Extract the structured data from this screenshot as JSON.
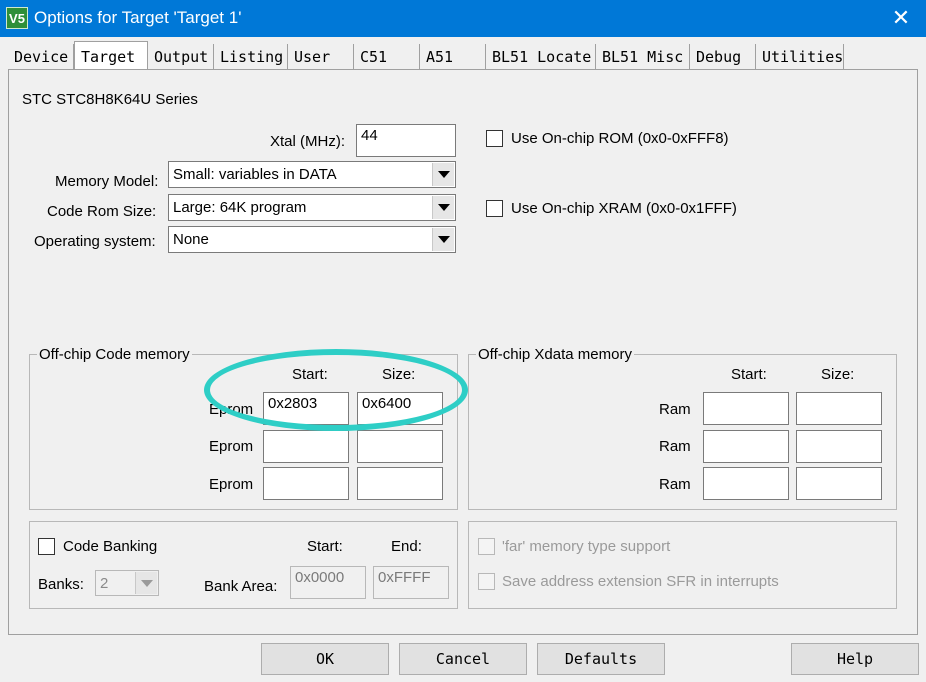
{
  "window": {
    "title": "Options for Target 'Target 1'",
    "app_icon_text": "V5",
    "close_glyph": "✕"
  },
  "tabs": [
    {
      "label": "Device"
    },
    {
      "label": "Target",
      "active": true
    },
    {
      "label": "Output"
    },
    {
      "label": "Listing"
    },
    {
      "label": "User"
    },
    {
      "label": "C51"
    },
    {
      "label": "A51"
    },
    {
      "label": "BL51 Locate"
    },
    {
      "label": "BL51 Misc"
    },
    {
      "label": "Debug"
    },
    {
      "label": "Utilities"
    }
  ],
  "target": {
    "device_series": "STC STC8H8K64U Series",
    "xtal_label": "Xtal (MHz):",
    "xtal_value": "44",
    "memory_model_label": "Memory Model:",
    "memory_model_value": "Small: variables in DATA",
    "code_rom_label": "Code Rom Size:",
    "code_rom_value": "Large: 64K program",
    "os_label": "Operating system:",
    "os_value": "None",
    "onchip_rom_label": "Use On-chip ROM (0x0-0xFFF8)",
    "onchip_xram_label": "Use On-chip XRAM (0x0-0x1FFF)"
  },
  "code_memory": {
    "title": "Off-chip Code memory",
    "start_header": "Start:",
    "size_header": "Size:",
    "rows": [
      {
        "label": "Eprom",
        "start": "0x2803",
        "size": "0x6400"
      },
      {
        "label": "Eprom",
        "start": "",
        "size": ""
      },
      {
        "label": "Eprom",
        "start": "",
        "size": ""
      }
    ]
  },
  "xdata_memory": {
    "title": "Off-chip Xdata memory",
    "start_header": "Start:",
    "size_header": "Size:",
    "rows": [
      {
        "label": "Ram",
        "start": "",
        "size": ""
      },
      {
        "label": "Ram",
        "start": "",
        "size": ""
      },
      {
        "label": "Ram",
        "start": "",
        "size": ""
      }
    ]
  },
  "banking": {
    "code_banking_label": "Code Banking",
    "banks_label": "Banks:",
    "banks_value": "2",
    "start_header": "Start:",
    "end_header": "End:",
    "bank_area_label": "Bank Area:",
    "bank_area_start": "0x0000",
    "bank_area_end": "0xFFFF"
  },
  "misc": {
    "far_memory_label": "'far' memory type support",
    "save_sfr_label": "Save address extension SFR in interrupts"
  },
  "buttons": {
    "ok": "OK",
    "cancel": "Cancel",
    "defaults": "Defaults",
    "help": "Help"
  },
  "colors": {
    "titlebar": "#0078d7",
    "annotation": "#2ecec6"
  }
}
